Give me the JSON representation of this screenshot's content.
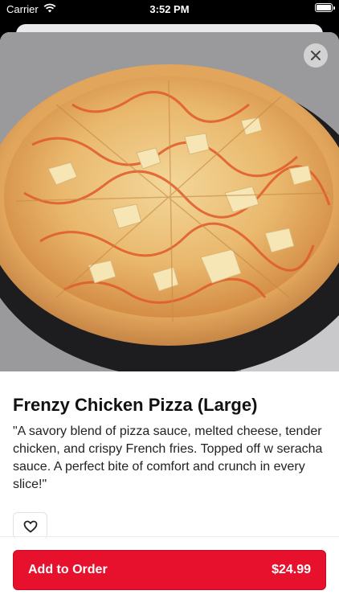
{
  "status_bar": {
    "carrier": "Carrier",
    "time": "3:52 PM"
  },
  "item": {
    "title": "Frenzy Chicken Pizza (Large)",
    "description": "\"A savory blend of pizza sauce, melted cheese, tender chicken, and crispy French fries. Topped off w seracha sauce. A perfect bite of comfort and crunch in every slice!\""
  },
  "footer": {
    "add_label": "Add to Order",
    "price": "$24.99"
  },
  "icons": {
    "close": "close-icon",
    "favorite": "heart-icon",
    "wifi": "wifi-icon",
    "battery": "battery-icon"
  },
  "colors": {
    "accent": "#e8112d"
  }
}
